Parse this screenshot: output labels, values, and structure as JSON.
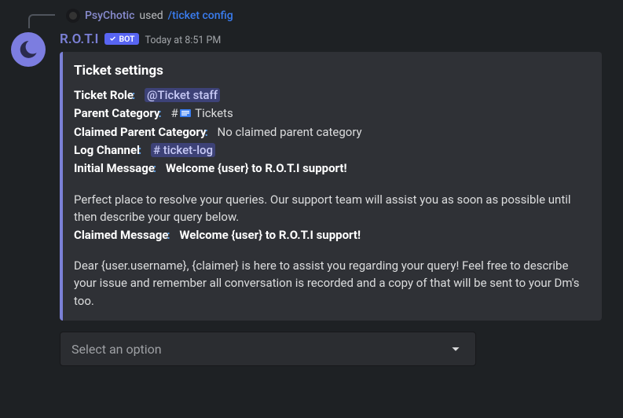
{
  "reply": {
    "user": "PsyChotic",
    "used": "used",
    "command": "/ticket config"
  },
  "header": {
    "bot_name": "R.O.T.I",
    "badge_label": "BOT",
    "timestamp": "Today at 8:51 PM"
  },
  "embed": {
    "title": "Ticket settings",
    "ticket_role_label": "Ticket Role",
    "ticket_role_value": "@Ticket staff",
    "parent_category_label": "Parent Category",
    "parent_category_value": "Tickets",
    "claimed_parent_label": "Claimed Parent Category",
    "claimed_parent_value": "No claimed parent category",
    "log_channel_label": "Log Channel",
    "log_channel_value": "# ticket-log",
    "initial_msg_label": "Initial Message",
    "initial_msg_value": "Welcome {user} to R.O.T.I support!",
    "initial_para": "Perfect place to resolve your queries. Our support team will assist you as soon as possible until then describe your query below.",
    "claimed_msg_label": "Claimed Message",
    "claimed_msg_value": "Welcome {user} to R.O.T.I support!",
    "claimed_para": "Dear {user.username}, {claimer} is here to assist you regarding your query! Feel free to describe your issue and remember all conversation is recorded and a copy of that will be sent to your Dm's too."
  },
  "select": {
    "placeholder": "Select an option"
  }
}
